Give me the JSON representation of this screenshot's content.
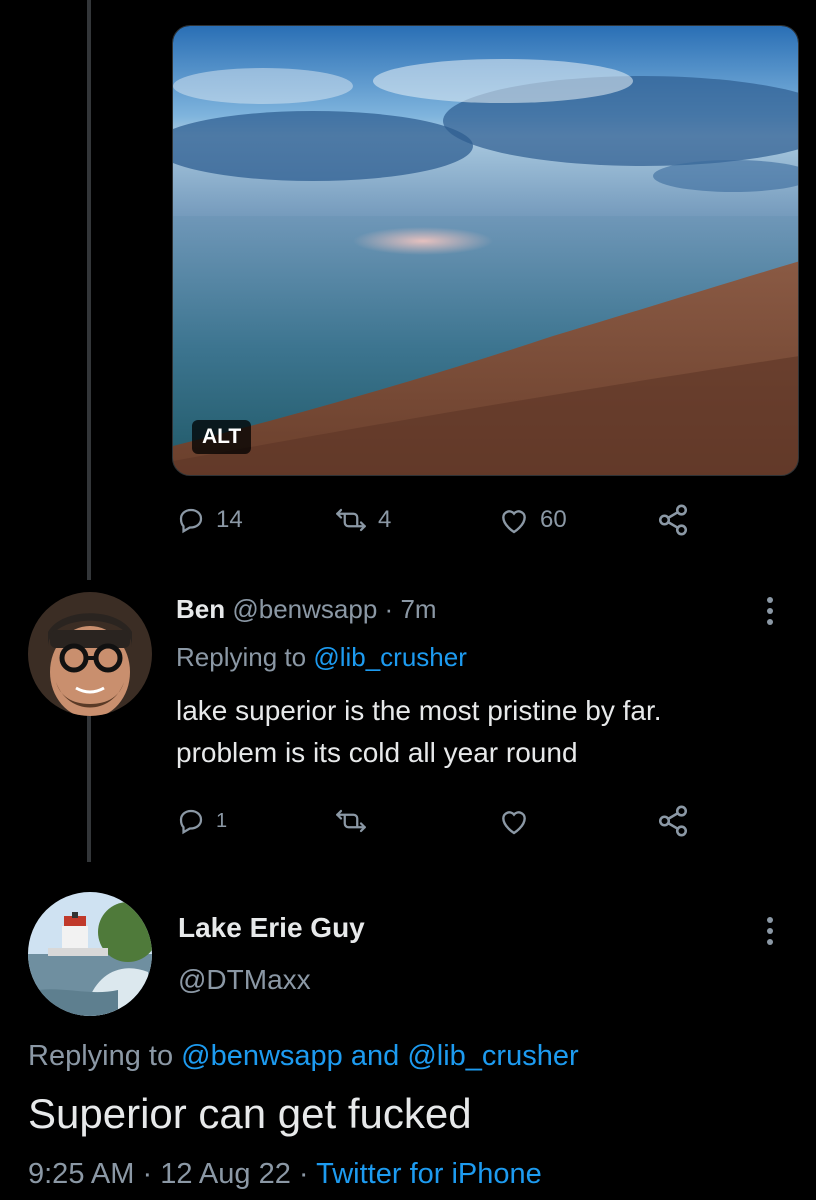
{
  "media": {
    "alt_label": "ALT"
  },
  "main_tweet_actions": {
    "replies": "14",
    "retweets": "4",
    "likes": "60"
  },
  "reply_tweet": {
    "display_name": "Ben",
    "handle": "@benwsapp",
    "separator": "·",
    "time": "7m",
    "replying_prefix": "Replying to",
    "replying_to": "@lib_crusher",
    "text_line1": "lake superior is the most pristine by far.",
    "text_line2": "problem is its cold all year round",
    "replies": "1"
  },
  "focus_tweet": {
    "display_name": "Lake Erie Guy",
    "handle": "@DTMaxx",
    "replying_prefix": "Replying to",
    "replying_user1": "@benwsapp",
    "replying_and": "and",
    "replying_user2": "@lib_crusher",
    "text": "Superior can get fucked",
    "time": "9:25 AM",
    "separator": "·",
    "date": "12 Aug 22",
    "separator2": "·",
    "source": "Twitter for iPhone"
  },
  "icons": [
    "reply-icon",
    "retweet-icon",
    "like-icon",
    "share-icon",
    "more-icon"
  ]
}
